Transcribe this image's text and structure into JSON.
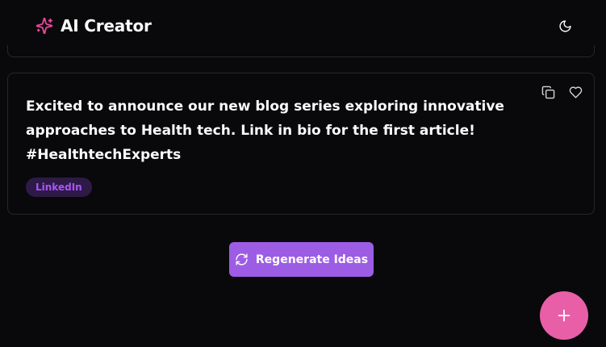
{
  "header": {
    "title": "AI Creator",
    "brand_icon": "sparkles-icon",
    "theme_toggle_icon": "moon-icon"
  },
  "idea_card": {
    "text": "Excited to announce our new blog series exploring innovative approaches to Health tech. Link in bio for the first article! #HealthtechExperts",
    "platform": "LinkedIn",
    "actions": [
      "copy-icon",
      "heart-icon"
    ]
  },
  "regenerate": {
    "label": "Regenerate Ideas",
    "icon": "refresh-icon"
  },
  "fab": {
    "icon": "plus-icon"
  },
  "colors": {
    "background": "#09090b",
    "brand_accent": "#ec4899",
    "button_purple": "#9c5de4",
    "fab_pink": "#e85fa8",
    "badge_text": "#a855f7",
    "border": "#27272a"
  }
}
